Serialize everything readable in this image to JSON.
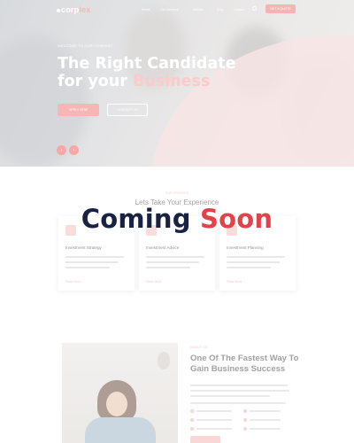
{
  "brand": {
    "logo_main": "corp",
    "logo_accent": "lex"
  },
  "nav": {
    "items": [
      "Home",
      "Our Services",
      "Articles",
      "Blog",
      "Contact"
    ],
    "cta": "GET A QUOTE"
  },
  "hero": {
    "kicker": "WELCOME TO OUR COMPANY",
    "title_line1": "The Right Candidate",
    "title_line2_prefix": "for your ",
    "title_line2_accent": "Business",
    "apply_button": "APPLY NOW",
    "contact_button": "CONTACT US",
    "prev_symbol": "‹",
    "next_symbol": "›"
  },
  "services": {
    "kicker": "OUR SERVICES",
    "title": "Lets Take Your Experience",
    "cards": [
      {
        "name": "Investment Strategy",
        "more": "Read More"
      },
      {
        "name": "Investment Advice",
        "more": "Read More"
      },
      {
        "name": "Investment Planning",
        "more": "Read More"
      }
    ]
  },
  "overlay": {
    "word1": "Coming",
    "word2": "Soon"
  },
  "about": {
    "kicker": "ABOUT US",
    "title": "One Of The Fastest Way To Gain Business Success"
  },
  "colors": {
    "accent": "#f7b3b3",
    "overlay_dark": "#1a2242",
    "overlay_red": "#e2434b"
  }
}
